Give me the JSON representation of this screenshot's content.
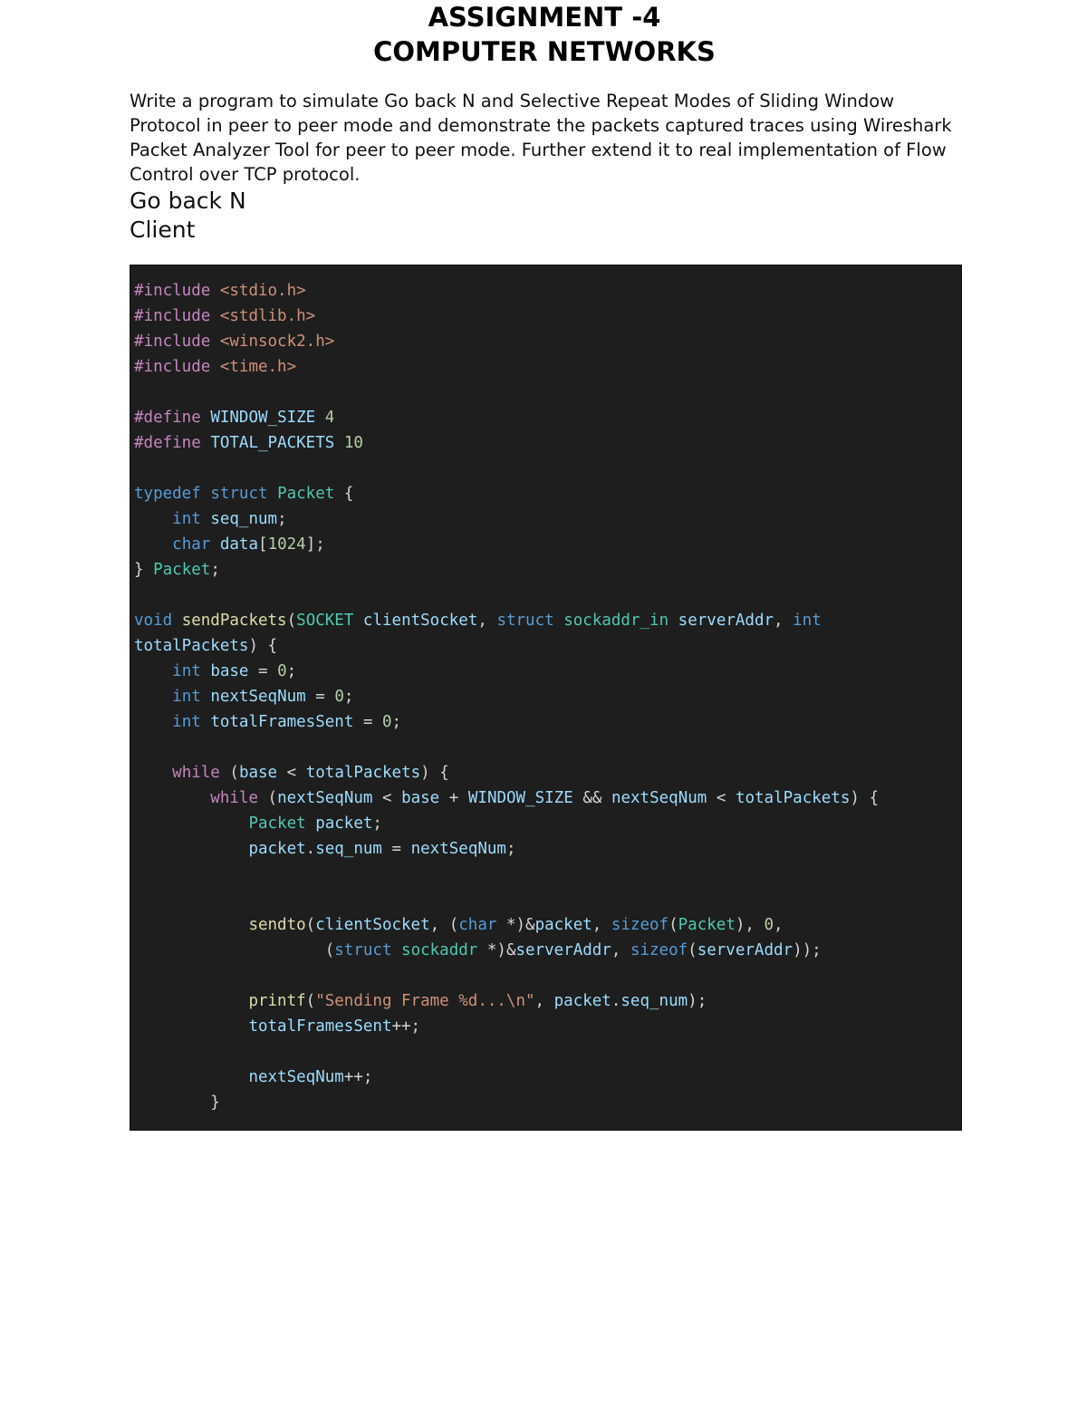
{
  "document": {
    "title_line_1": "ASSIGNMENT -4",
    "title_line_2": "COMPUTER NETWORKS",
    "intro_paragraph": "Write a program to simulate Go back N and Selective Repeat Modes of Sliding Window Protocol in peer to peer mode and demonstrate the packets captured traces using Wireshark Packet Analyzer Tool for peer to peer mode. Further extend it to real implementation of Flow Control over TCP protocol.",
    "section_heading": "Go back N",
    "subsection_heading": "Client"
  },
  "code_block": {
    "language": "c",
    "background_color": "#1e1e1e",
    "theme_colors": {
      "keyword": "#569cd6",
      "control_keyword": "#c586c0",
      "type": "#4ec9b0",
      "function": "#dcdcaa",
      "variable": "#9cdcfe",
      "number": "#b5cea8",
      "string": "#ce9178",
      "plain": "#d4d4d4"
    },
    "lines": [
      "#include <stdio.h>",
      "#include <stdlib.h>",
      "#include <winsock2.h>",
      "#include <time.h>",
      "",
      "#define WINDOW_SIZE 4",
      "#define TOTAL_PACKETS 10",
      "",
      "typedef struct Packet {",
      "    int seq_num;",
      "    char data[1024];",
      "} Packet;",
      "",
      "void sendPackets(SOCKET clientSocket, struct sockaddr_in serverAddr, int totalPackets) {",
      "    int base = 0;",
      "    int nextSeqNum = 0;",
      "    int totalFramesSent = 0;",
      "",
      "    while (base < totalPackets) {",
      "        while (nextSeqNum < base + WINDOW_SIZE && nextSeqNum < totalPackets) {",
      "            Packet packet;",
      "            packet.seq_num = nextSeqNum;",
      "",
      "",
      "            sendto(clientSocket, (char *)&packet, sizeof(Packet), 0,",
      "                    (struct sockaddr *)&serverAddr, sizeof(serverAddr));",
      "",
      "            printf(\"Sending Frame %d...\\n\", packet.seq_num);",
      "            totalFramesSent++;",
      "",
      "            nextSeqNum++;",
      "        }"
    ]
  }
}
